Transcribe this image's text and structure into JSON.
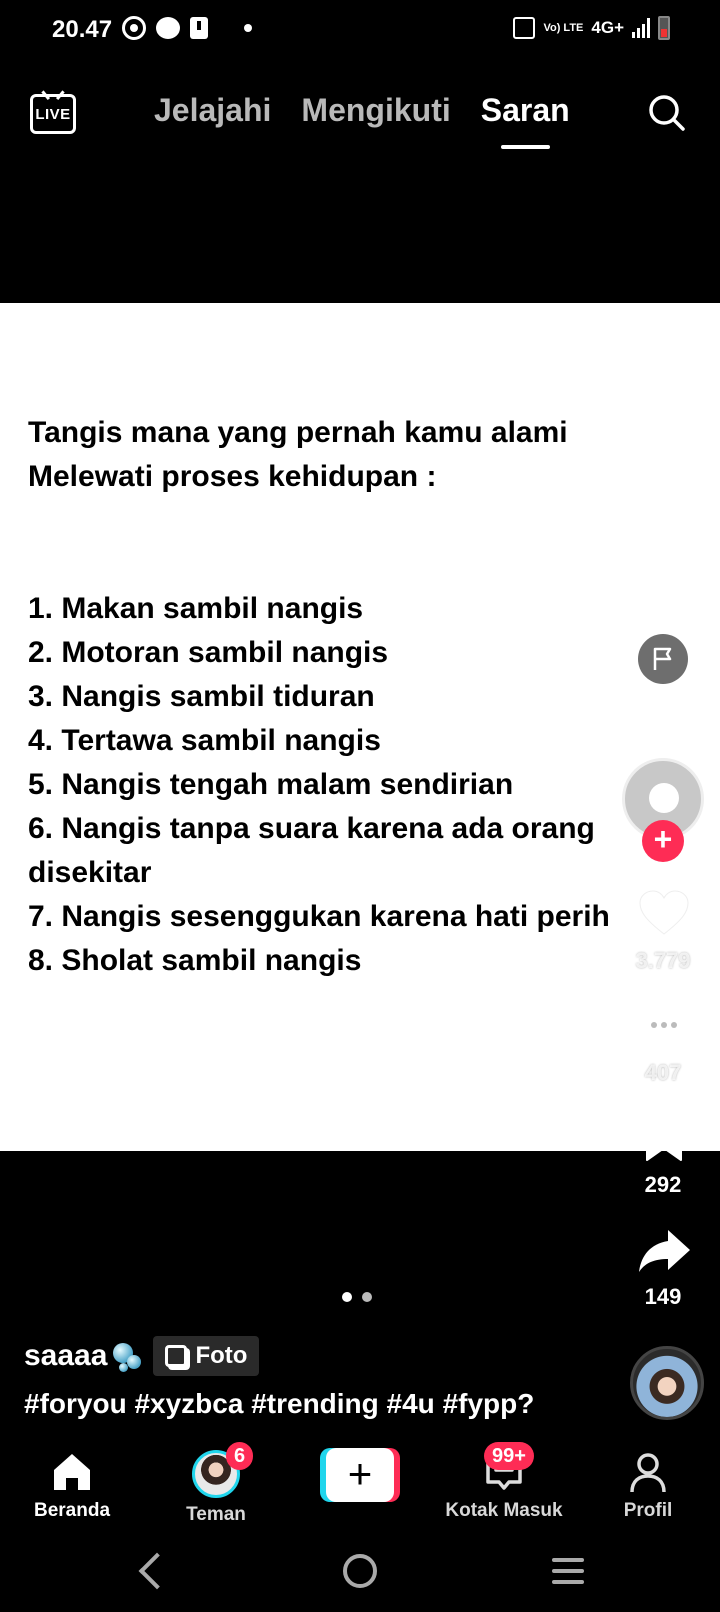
{
  "status": {
    "time": "20.47",
    "network": "4G+",
    "volte_label": "Vo) LTE"
  },
  "top_nav": {
    "live_label": "LIVE",
    "tabs": [
      "Jelajahi",
      "Mengikuti",
      "Saran"
    ],
    "active_tab": "Saran"
  },
  "post": {
    "heading_line1": "Tangis mana yang pernah kamu alami",
    "heading_line2": "Melewati proses kehidupan :",
    "list": [
      "1. Makan sambil nangis",
      "2. Motoran sambil nangis",
      "3. Nangis sambil tiduran",
      "4. Tertawa sambil nangis",
      "5. Nangis tengah malam sendirian",
      "6. Nangis tanpa suara karena ada orang",
      "disekitar",
      "7. Nangis sesenggukan karena hati perih",
      "8. Sholat sambil nangis"
    ]
  },
  "rail": {
    "likes": "3.779",
    "comments": "407",
    "saves": "292",
    "shares": "149"
  },
  "carousel": {
    "current": 1,
    "total": 2
  },
  "caption": {
    "author": "saaaa",
    "type_label": "Foto",
    "hashtags": "#foryou #xyzbca #trending #4u #fypp?"
  },
  "bottom_nav": {
    "home": "Beranda",
    "friends": "Teman",
    "friends_badge": "6",
    "inbox": "Kotak Masuk",
    "inbox_badge": "99+",
    "profile": "Profil",
    "active": "Beranda"
  },
  "colors": {
    "accent_red": "#fe2c55",
    "accent_cyan": "#20d5ec",
    "background": "#000000"
  },
  "icons": [
    "whatsapp-icon",
    "chat-icon",
    "alert-icon",
    "live-icon",
    "search-icon",
    "flag-icon",
    "heart-icon",
    "comment-icon",
    "bookmark-icon",
    "share-icon",
    "home-icon",
    "inbox-icon",
    "profile-icon"
  ]
}
